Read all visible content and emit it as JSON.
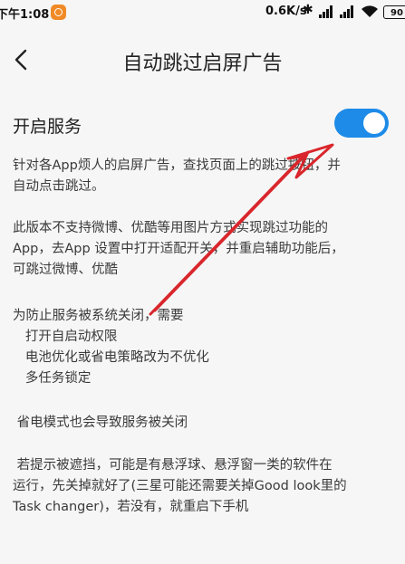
{
  "status_bar": {
    "time": "下午1:08",
    "net_speed": "0.6K/s",
    "battery": "90"
  },
  "header": {
    "title": "自动跳过启屏广告"
  },
  "service": {
    "label": "开启服务",
    "enabled": true
  },
  "description": {
    "p1": [
      "针对各App烦人的启屏广告，查找页面上的跳过按钮，并",
      "自动点击跳过。"
    ],
    "p2": [
      "此版本不支持微博、优酷等用图片方式实现跳过功能的",
      "App，去App 设置中打开适配开关，并重启辅助功能后，",
      "可跳过微博、优酷"
    ],
    "p3": [
      "为防止服务被系统关闭，需要",
      "   打开自启动权限",
      "   电池优化或省电策略改为不优化",
      "   多任务锁定"
    ],
    "p4": [
      " 省电模式也会导致服务被关闭"
    ],
    "p5": [
      " 若提示被遮挡，可能是有悬浮球、悬浮窗一类的软件在",
      "运行，先关掉就好了(三星可能还需要关掉Good look里的",
      "Task changer)，若没有，就重启下手机"
    ]
  },
  "colors": {
    "accent": "#1e8be8",
    "annotation_arrow": "#d9262c",
    "background": "#f6f6f6"
  }
}
